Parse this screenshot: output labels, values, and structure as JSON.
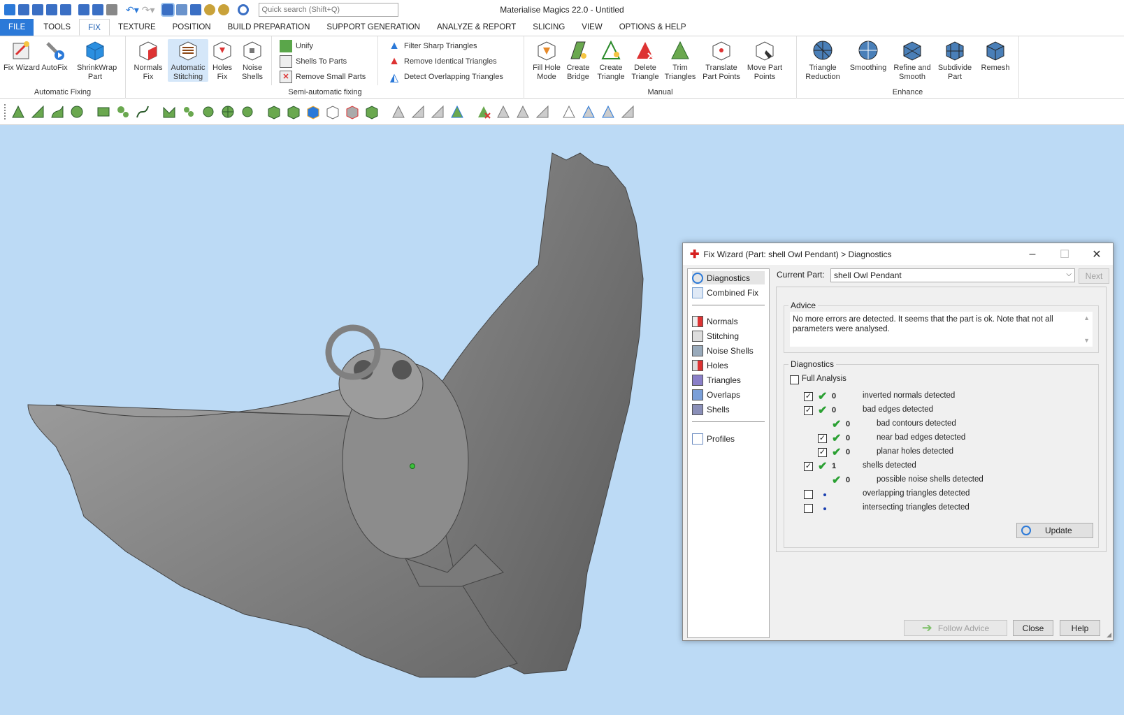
{
  "app": {
    "title": "Materialise Magics 22.0 - Untitled",
    "search_placeholder": "Quick search (Shift+Q)"
  },
  "tabs": [
    "FILE",
    "TOOLS",
    "FIX",
    "TEXTURE",
    "POSITION",
    "BUILD PREPARATION",
    "SUPPORT GENERATION",
    "ANALYZE & REPORT",
    "SLICING",
    "VIEW",
    "OPTIONS & HELP"
  ],
  "ribbon": {
    "automatic_fixing": {
      "label": "Automatic Fixing",
      "buttons": [
        "Fix Wizard",
        "AutoFix",
        "ShrinkWrap Part"
      ]
    },
    "semi_left": {
      "buttons": [
        "Normals Fix",
        "Automatic Stitching",
        "Holes Fix",
        "Noise Shells"
      ]
    },
    "semi_automatic": {
      "label": "Semi-automatic fixing",
      "small": [
        "Unify",
        "Shells To Parts",
        "Remove Small Parts"
      ],
      "small2": [
        "Filter Sharp Triangles",
        "Remove Identical Triangles",
        "Detect Overlapping Triangles"
      ]
    },
    "manual": {
      "label": "Manual",
      "buttons": [
        "Fill Hole Mode",
        "Create Bridge",
        "Create Triangle",
        "Delete Triangle",
        "Trim Triangles",
        "Translate Part Points",
        "Move Part Points"
      ]
    },
    "enhance": {
      "label": "Enhance",
      "buttons": [
        "Triangle Reduction",
        "Smoothing",
        "Refine and Smooth",
        "Subdivide Part",
        "Remesh"
      ]
    }
  },
  "dialog": {
    "title": "Fix Wizard (Part: shell Owl Pendant) > Diagnostics",
    "nav": [
      "Diagnostics",
      "Combined Fix",
      "Normals",
      "Stitching",
      "Noise Shells",
      "Holes",
      "Triangles",
      "Overlaps",
      "Shells",
      "Profiles"
    ],
    "current_part_label": "Current Part:",
    "current_part_value": "shell Owl Pendant",
    "next_label": "Next",
    "advice_label": "Advice",
    "advice_text": "No more errors are detected. It seems that the part is ok. Note that not all parameters were analysed.",
    "diagnostics_label": "Diagnostics",
    "full_analysis_label": "Full Analysis",
    "rows": [
      {
        "checkbox": true,
        "checked": true,
        "status": "ok",
        "value": "0",
        "text": "inverted normals detected",
        "indent": 0
      },
      {
        "checkbox": true,
        "checked": true,
        "status": "ok",
        "value": "0",
        "text": "bad edges detected",
        "indent": 0
      },
      {
        "checkbox": false,
        "checked": false,
        "status": "ok",
        "value": "0",
        "text": "bad contours detected",
        "indent": 1
      },
      {
        "checkbox": true,
        "checked": true,
        "status": "ok",
        "value": "0",
        "text": "near bad edges detected",
        "indent": 1
      },
      {
        "checkbox": true,
        "checked": true,
        "status": "ok",
        "value": "0",
        "text": "planar holes detected",
        "indent": 1
      },
      {
        "checkbox": true,
        "checked": true,
        "status": "ok",
        "value": "1",
        "text": "shells detected",
        "indent": 0
      },
      {
        "checkbox": false,
        "checked": false,
        "status": "ok",
        "value": "0",
        "text": "possible noise shells detected",
        "indent": 1
      },
      {
        "checkbox": true,
        "checked": false,
        "status": "pending",
        "value": "",
        "text": "overlapping triangles detected",
        "indent": 0
      },
      {
        "checkbox": true,
        "checked": false,
        "status": "pending",
        "value": "",
        "text": "intersecting triangles detected",
        "indent": 0
      }
    ],
    "update_label": "Update",
    "follow_advice_label": "Follow Advice",
    "close_label": "Close",
    "help_label": "Help"
  },
  "colors": {
    "viewport_bg": "#bcdaf5",
    "file_tab": "#2b79d8",
    "check_green": "#2aa032",
    "model_gray": "#8a8a8a"
  }
}
